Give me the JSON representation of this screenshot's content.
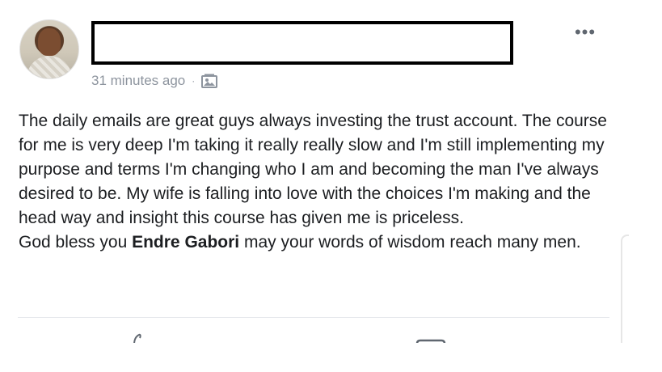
{
  "post": {
    "timestamp": "31 minutes ago",
    "separator": "·",
    "audience_icon": "photo-album-icon",
    "more_label": "•••",
    "text_lines_p1": "The daily emails are great guys always investing the trust account. The course for me is very deep I'm taking it really really slow and I'm still implementing my purpose and terms I'm changing who I am and becoming the man I've always desired to be. My wife is falling into love with the choices I'm making and the head way and insight this course has given me is priceless.",
    "p2_before": "God bless you ",
    "p2_mention": "Endre Gabori",
    "p2_after": " may your words of wisdom reach many men."
  },
  "colors": {
    "text": "#1c1e21",
    "meta": "#8d949e",
    "redaction_border": "#000000",
    "divider": "#e4e6eb"
  }
}
